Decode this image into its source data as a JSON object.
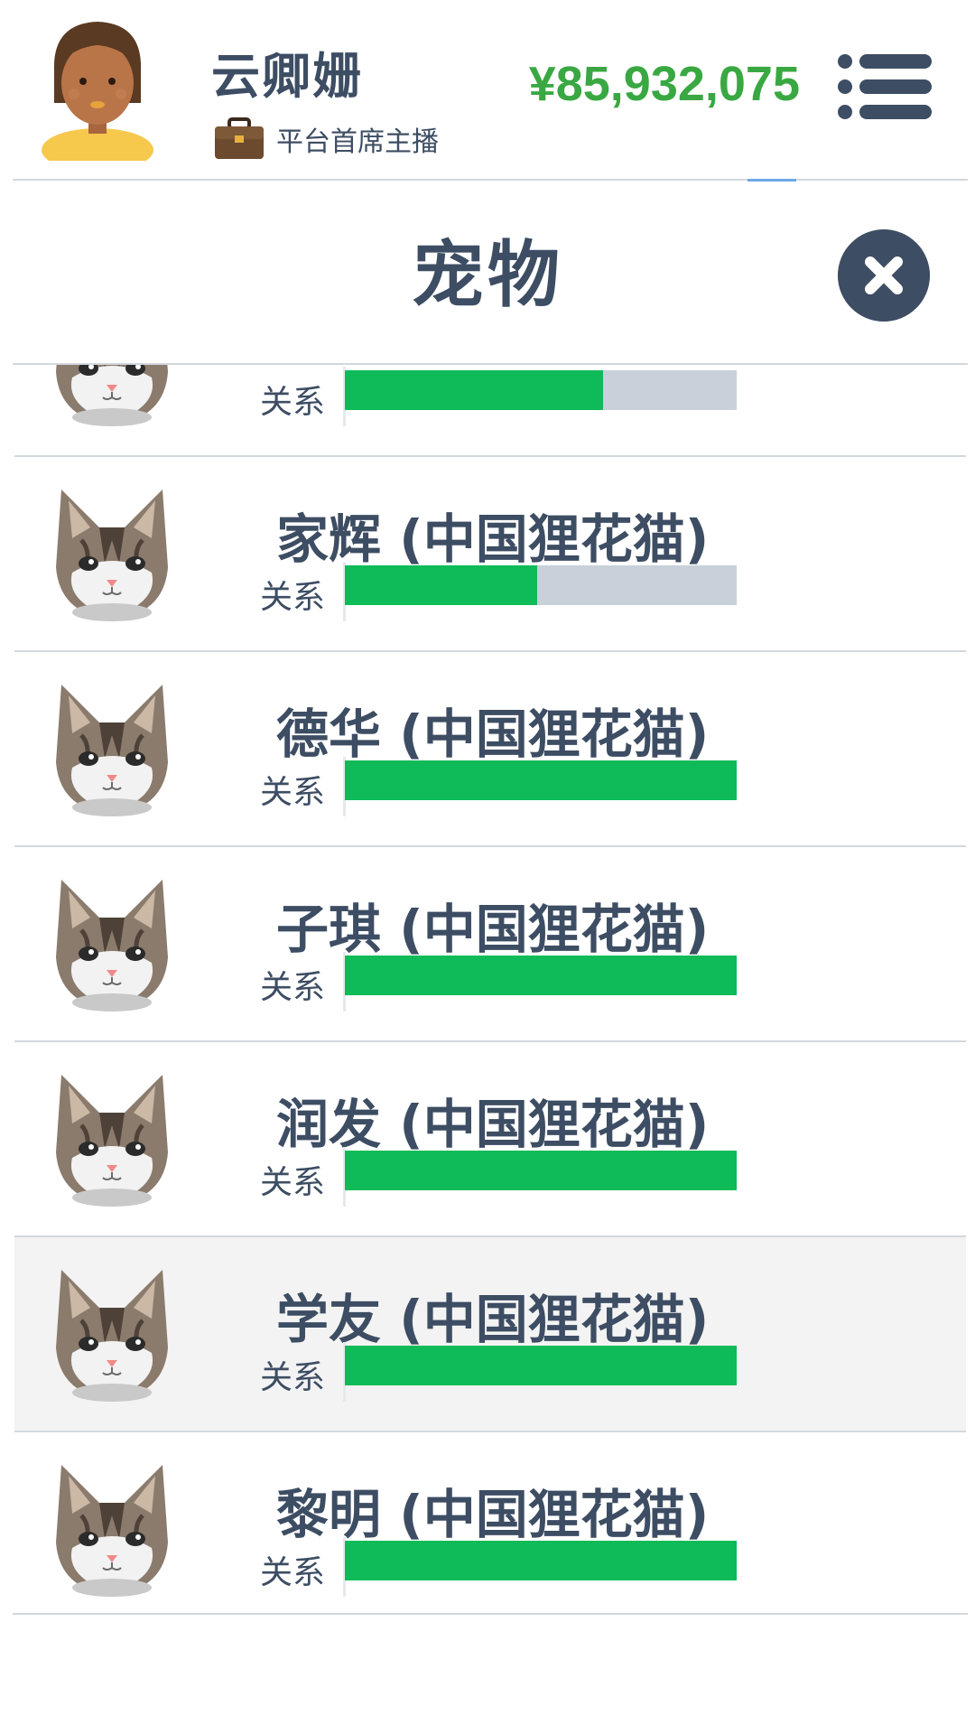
{
  "header": {
    "username": "云卿姗",
    "user_title": "平台首席主播",
    "money": "¥85,932,075"
  },
  "modal": {
    "title": "宠物"
  },
  "pets": [
    {
      "name": "",
      "relation_label": "关系",
      "relation": 0.66
    },
    {
      "name": "家辉 (中国狸花猫)",
      "relation_label": "关系",
      "relation": 0.49
    },
    {
      "name": "德华 (中国狸花猫)",
      "relation_label": "关系",
      "relation": 1.0
    },
    {
      "name": "子琪 (中国狸花猫)",
      "relation_label": "关系",
      "relation": 1.0
    },
    {
      "name": "润发 (中国狸花猫)",
      "relation_label": "关系",
      "relation": 1.0
    },
    {
      "name": "学友 (中国狸花猫)",
      "relation_label": "关系",
      "relation": 1.0,
      "selected": true
    },
    {
      "name": "黎明 (中国狸花猫)",
      "relation_label": "关系",
      "relation": 1.0
    }
  ],
  "colors": {
    "primary_text": "#3d4d63",
    "money": "#3aa842",
    "relation_fill": "#0ebb58",
    "relation_track": "#c8d0da",
    "selected_row": "#f3f3f3"
  },
  "icons": {
    "avatar": "female-avatar-icon",
    "briefcase": "briefcase-icon",
    "menu": "menu-list-icon",
    "close": "close-icon",
    "pet": "tabby-cat-icon"
  }
}
